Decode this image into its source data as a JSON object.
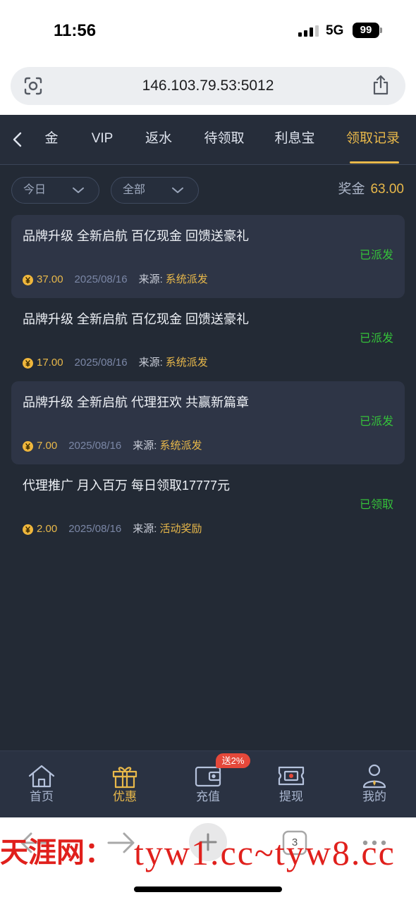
{
  "status_bar": {
    "time": "11:56",
    "network": "5G",
    "battery": "99",
    "signal_icon": "cellular-signal-icon"
  },
  "browser": {
    "url": "146.103.79.53:5012",
    "tab_count": "3",
    "icons": [
      "scan-icon",
      "share-icon",
      "back-arrow-icon",
      "forward-arrow-icon",
      "plus-icon",
      "tabs-icon",
      "more-icon"
    ]
  },
  "nav": {
    "back_icon": "chevron-left-icon",
    "tabs": [
      {
        "label": "金"
      },
      {
        "label": "VIP"
      },
      {
        "label": "返水"
      },
      {
        "label": "待领取"
      },
      {
        "label": "利息宝"
      },
      {
        "label": "领取记录",
        "active": true
      }
    ]
  },
  "filters": {
    "period": "今日",
    "category": "全部",
    "bonus_label": "奖金",
    "bonus_value": "63.00"
  },
  "records": [
    {
      "title": "品牌升级 全新启航 百亿现金 回馈送豪礼",
      "status": "已派发",
      "amount": "37.00",
      "date": "2025/08/16",
      "source_label": "来源:",
      "source": "系统派发"
    },
    {
      "title": "品牌升级 全新启航 百亿现金 回馈送豪礼",
      "status": "已派发",
      "amount": "17.00",
      "date": "2025/08/16",
      "source_label": "来源:",
      "source": "系统派发"
    },
    {
      "title": "品牌升级 全新启航 代理狂欢 共赢新篇章",
      "status": "已派发",
      "amount": "7.00",
      "date": "2025/08/16",
      "source_label": "来源:",
      "source": "系统派发"
    },
    {
      "title": "代理推广 月入百万 每日领取17777元",
      "status": "已领取",
      "amount": "2.00",
      "date": "2025/08/16",
      "source_label": "来源:",
      "source": "活动奖励"
    }
  ],
  "tabbar": {
    "items": [
      {
        "label": "首页",
        "icon": "home-icon"
      },
      {
        "label": "优惠",
        "icon": "gift-icon",
        "active": true
      },
      {
        "label": "充值",
        "icon": "wallet-icon",
        "badge": "送2%"
      },
      {
        "label": "提现",
        "icon": "withdraw-icon"
      },
      {
        "label": "我的",
        "icon": "user-icon"
      }
    ]
  },
  "watermark": {
    "site": "天涯网：",
    "domains": "tyw1.cc~tyw8.cc"
  },
  "colors": {
    "background": "#232a35",
    "card": "#2e3546",
    "accent_gold": "#e8b84a",
    "status_green": "#35c23a",
    "badge_red": "#e5483a",
    "watermark_red": "#e0201c"
  }
}
